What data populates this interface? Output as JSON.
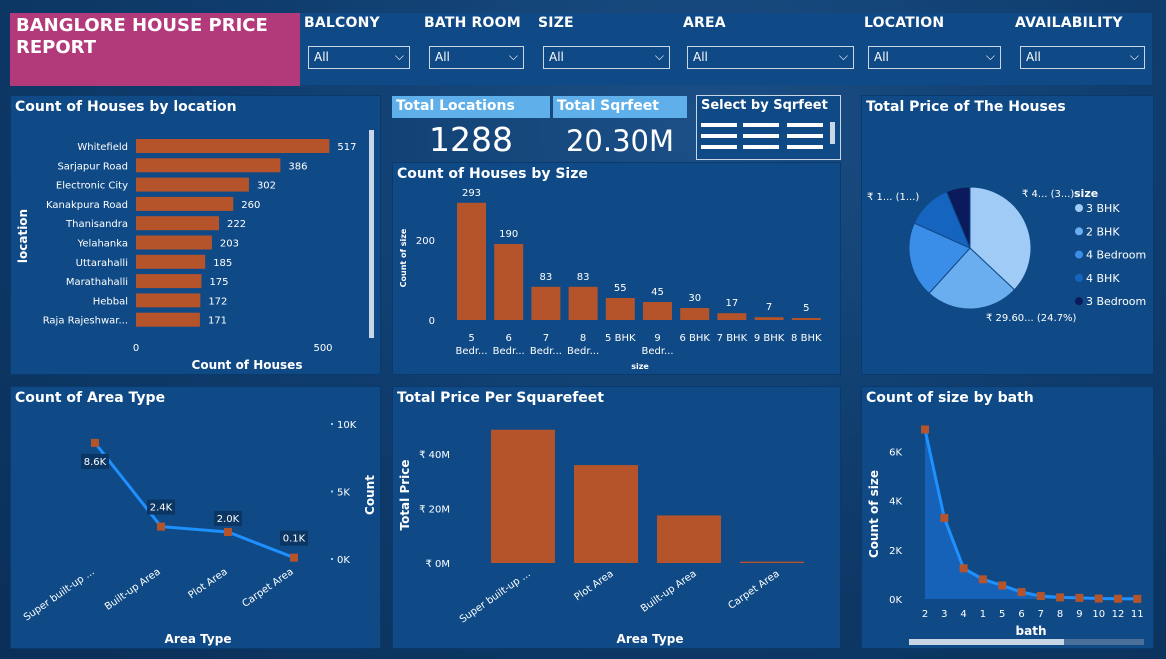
{
  "report_title": "BANGLORE HOUSE PRICE REPORT",
  "filters": [
    {
      "label": "BALCONY",
      "value": "All"
    },
    {
      "label": "BATH ROOM",
      "value": "All"
    },
    {
      "label": "SIZE",
      "value": "All"
    },
    {
      "label": "AREA",
      "value": "All"
    },
    {
      "label": "LOCATION",
      "value": "All"
    },
    {
      "label": "AVAILABILITY",
      "value": "All"
    }
  ],
  "kpis": {
    "total_locations": {
      "label": "Total Locations",
      "value": "1288"
    },
    "total_sqrfeet": {
      "label": "Total Sqrfeet",
      "value": "20.30M"
    },
    "select_by_sqrfeet": {
      "label": "Select by Sqrfeet"
    }
  },
  "colors": {
    "bar": "#b5532a",
    "line": "#1e90ff",
    "marker": "#b5532a",
    "panel": "#0f4a86"
  },
  "chart_data": [
    {
      "id": "location",
      "type": "bar",
      "orientation": "horizontal",
      "title": "Count of Houses by location",
      "xlabel": "Count of Houses",
      "ylabel": "location",
      "categories": [
        "Whitefield",
        "Sarjapur Road",
        "Electronic City",
        "Kanakpura Road",
        "Thanisandra",
        "Yelahanka",
        "Uttarahalli",
        "Marathahalli",
        "Hebbal",
        "Raja Rajeshwar..."
      ],
      "values": [
        517,
        386,
        302,
        260,
        222,
        203,
        185,
        175,
        172,
        171
      ],
      "value_labels": [
        "517",
        "386",
        "302",
        "260",
        "222",
        "203",
        "185",
        "175",
        "172",
        "171"
      ],
      "ticks": [
        "0",
        "500"
      ],
      "xlim": [
        0,
        530
      ]
    },
    {
      "id": "size",
      "type": "bar",
      "title": "Count of Houses by Size",
      "xlabel": "size",
      "ylabel": "Count of size",
      "categories": [
        [
          "5",
          "Bedr..."
        ],
        [
          "6",
          "Bedr..."
        ],
        [
          "7",
          "Bedr..."
        ],
        [
          "8",
          "Bedr..."
        ],
        [
          "5 BHK"
        ],
        [
          "9",
          "Bedr..."
        ],
        [
          "6 BHK"
        ],
        [
          "7 BHK"
        ],
        [
          "9 BHK"
        ],
        [
          "8 BHK"
        ]
      ],
      "values": [
        293,
        190,
        83,
        83,
        55,
        45,
        30,
        17,
        7,
        5
      ],
      "value_labels": [
        "293",
        "190",
        "83",
        "83",
        "55",
        "45",
        "30",
        "17",
        "7",
        "5"
      ],
      "ticks": [
        "0",
        "200"
      ],
      "ylim": [
        0,
        300
      ]
    },
    {
      "id": "price_pie",
      "type": "pie",
      "title": "Total Price of The Houses",
      "legend_title": "size",
      "legend": [
        "3 BHK",
        "2 BHK",
        "4 Bedroom",
        "4 BHK",
        "3 Bedroom"
      ],
      "slice_colors": [
        "#9fcbf6",
        "#6aaeef",
        "#3a8ee8",
        "#1565c0",
        "#0a1a5a"
      ],
      "values": [
        37,
        24.7,
        20,
        12,
        6.3
      ],
      "slice_labels": [
        "₹ 4... (3...)",
        "₹ 29.60... (24.7%)",
        "₹ 1... (1...)"
      ]
    },
    {
      "id": "area_type",
      "type": "line",
      "title": "Count of Area Type",
      "xlabel": "Area Type",
      "ylabel": "Count",
      "categories": [
        "Super built-up ...",
        "Built-up Area",
        "Plot Area",
        "Carpet Area"
      ],
      "values": [
        8600,
        2400,
        2000,
        100
      ],
      "value_labels": [
        "8.6K",
        "2.4K",
        "2.0K",
        "0.1K"
      ],
      "ticks": [
        "10K",
        "5K",
        "0K"
      ],
      "ylim": [
        0,
        10000
      ]
    },
    {
      "id": "price_sqft",
      "type": "bar",
      "title": "Total Price Per Squarefeet",
      "xlabel": "Area Type",
      "ylabel": "Total Price",
      "categories": [
        "Super built-up ...",
        "Plot Area",
        "Built-up Area",
        "Carpet Area"
      ],
      "values": [
        49,
        36,
        17.5,
        0.5
      ],
      "ticks": [
        "₹ 40M",
        "₹ 20M",
        "₹ 0M"
      ],
      "ylim": [
        0,
        50
      ]
    },
    {
      "id": "bath",
      "type": "area",
      "title": "Count of size by bath",
      "xlabel": "bath",
      "ylabel": "Count of size",
      "categories": [
        "2",
        "3",
        "4",
        "1",
        "5",
        "6",
        "7",
        "8",
        "9",
        "10",
        "12",
        "11"
      ],
      "values": [
        6900,
        3300,
        1250,
        800,
        550,
        280,
        120,
        65,
        45,
        20,
        10,
        5
      ],
      "ticks": [
        "6K",
        "4K",
        "2K",
        "0K"
      ],
      "ylim": [
        0,
        7000
      ]
    }
  ]
}
